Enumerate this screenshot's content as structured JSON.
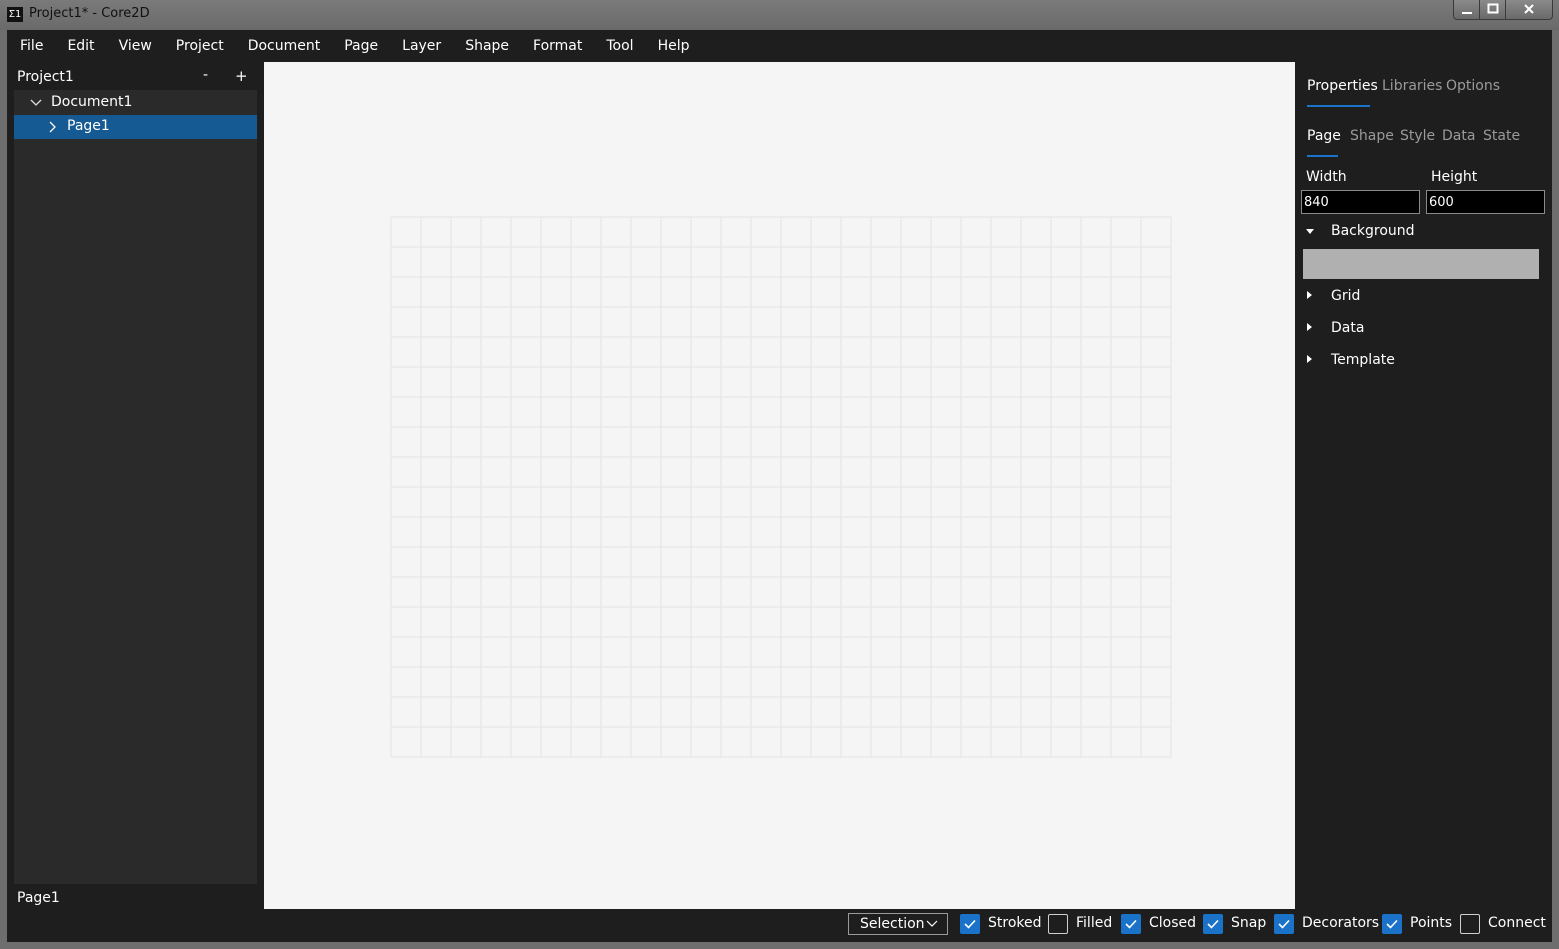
{
  "window": {
    "title": "Project1* - Core2D",
    "icon_text": "Σ1",
    "minimize_glyph": "▁",
    "maximize_glyph": "□",
    "close_glyph": "✕"
  },
  "menu": {
    "items": [
      "File",
      "Edit",
      "View",
      "Project",
      "Document",
      "Page",
      "Layer",
      "Shape",
      "Format",
      "Tool",
      "Help"
    ]
  },
  "explorer": {
    "project_name": "Project1",
    "remove_label": "-",
    "add_label": "+",
    "document_name": "Document1",
    "page_name": "Page1",
    "footer_label": "Page1"
  },
  "properties": {
    "tabs": [
      "Properties",
      "Libraries",
      "Options"
    ],
    "active_tab": "Properties",
    "subtabs": [
      "Page",
      "Shape",
      "Style",
      "Data",
      "State"
    ],
    "active_subtab": "Page",
    "width_label": "Width",
    "width_value": "840",
    "height_label": "Height",
    "height_value": "600",
    "sections": {
      "background": "Background",
      "grid": "Grid",
      "data": "Data",
      "template": "Template"
    },
    "background_color": "#b0b0b0"
  },
  "canvas": {
    "background_color": "#f5f5f5",
    "grid_line_color": "#e3e3e3"
  },
  "statusbar": {
    "tool": "Selection",
    "checkboxes": [
      {
        "label": "Stroked",
        "checked": true
      },
      {
        "label": "Filled",
        "checked": false
      },
      {
        "label": "Closed",
        "checked": true
      },
      {
        "label": "Snap",
        "checked": true
      },
      {
        "label": "Decorators",
        "checked": true
      },
      {
        "label": "Points",
        "checked": true
      },
      {
        "label": "Connect",
        "checked": false
      }
    ]
  },
  "colors": {
    "accent": "#1a73c8",
    "selection": "#155a92",
    "panel": "#1e1e1e",
    "tree_bg": "#2a2a2a"
  }
}
